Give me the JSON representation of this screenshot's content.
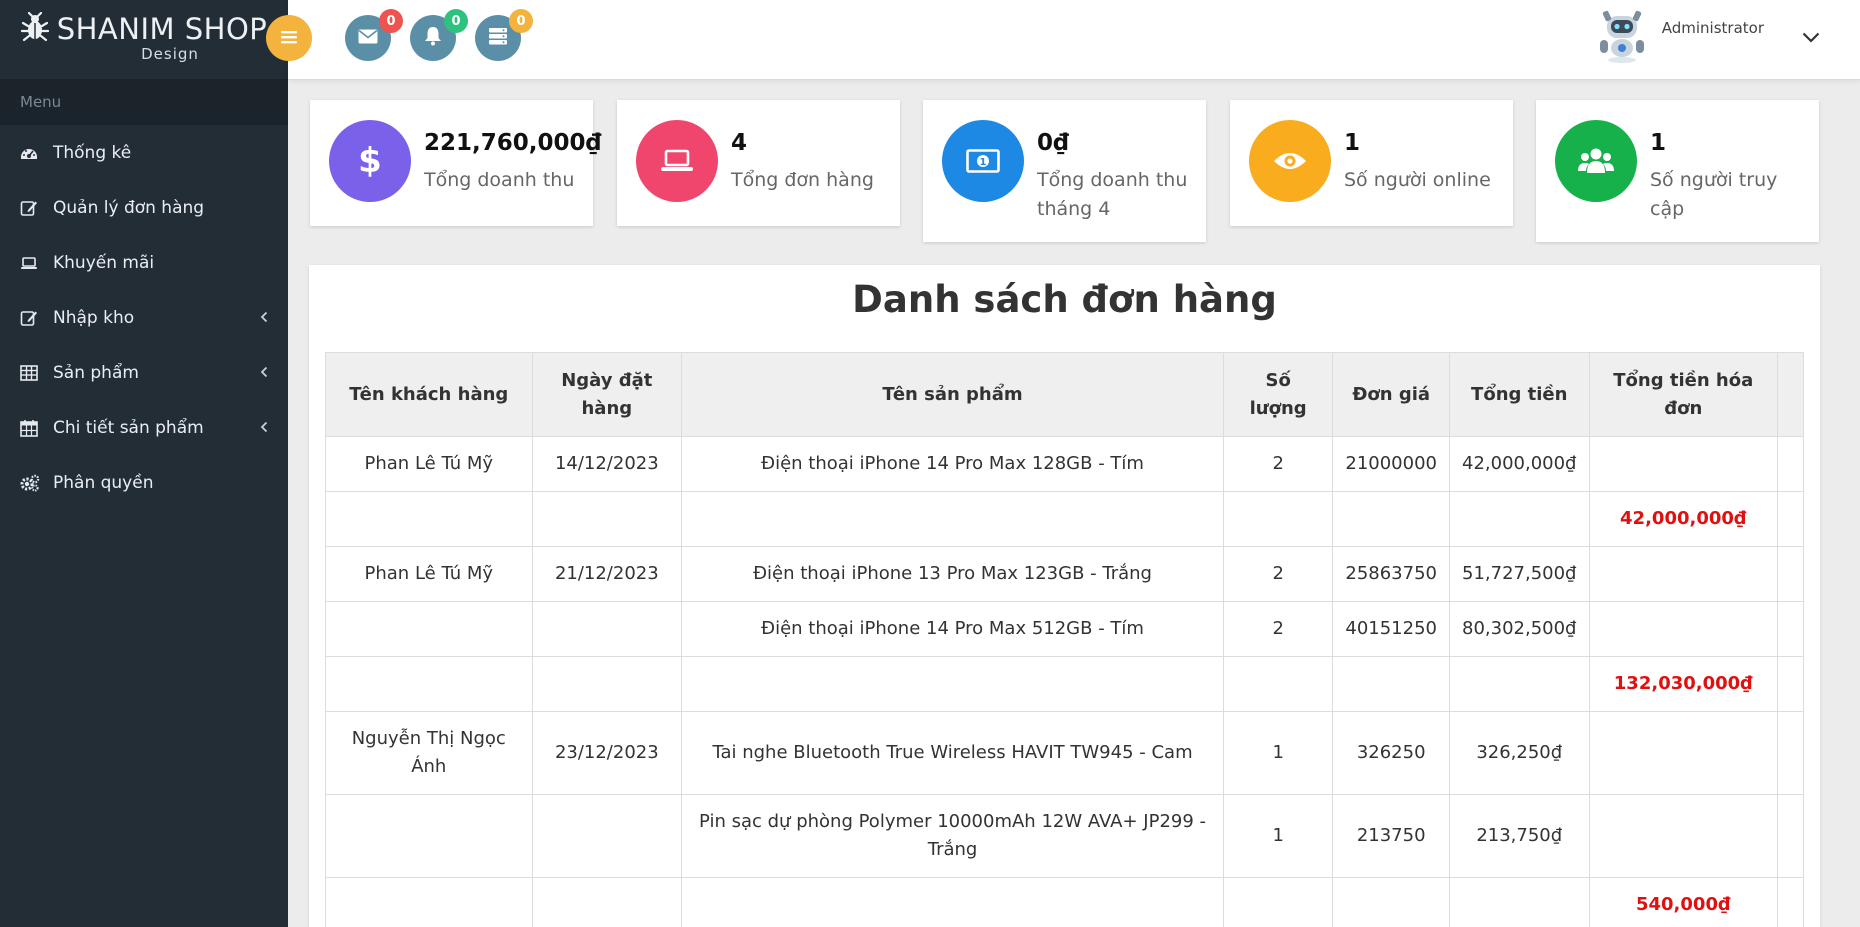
{
  "brand": {
    "title": "SHANIM SHOP",
    "subtitle": "Design"
  },
  "sidebar": {
    "menu_header": "Menu",
    "items": [
      {
        "label": "Thống kê",
        "icon": "dashboard-icon",
        "has_submenu": false
      },
      {
        "label": "Quản lý đơn hàng",
        "icon": "edit-icon",
        "has_submenu": false
      },
      {
        "label": "Khuyến mãi",
        "icon": "laptop-icon",
        "has_submenu": false
      },
      {
        "label": "Nhập kho",
        "icon": "edit-icon",
        "has_submenu": true
      },
      {
        "label": "Sản phẩm",
        "icon": "table-icon",
        "has_submenu": true
      },
      {
        "label": "Chi tiết sản phẩm",
        "icon": "calendar-icon",
        "has_submenu": true
      },
      {
        "label": "Phân quyền",
        "icon": "gears-icon",
        "has_submenu": false
      }
    ]
  },
  "header": {
    "badges": {
      "messages": "0",
      "notifications": "0",
      "tasks": "0"
    },
    "user_name": "Administrator"
  },
  "stats": [
    {
      "value": "221,760,000₫",
      "label": "Tổng doanh thu",
      "icon": "dollar-icon",
      "color": "#7b61ea"
    },
    {
      "value": "4",
      "label": "Tổng đơn hàng",
      "icon": "laptop-icon",
      "color": "#f0466e"
    },
    {
      "value": "0₫",
      "label": "Tổng doanh thu tháng 4",
      "icon": "money-icon",
      "color": "#1e88e5"
    },
    {
      "value": "1",
      "label": "Số người online",
      "icon": "eye-icon",
      "color": "#f9ac1e"
    },
    {
      "value": "1",
      "label": "Số người truy cập",
      "icon": "users-icon",
      "color": "#16b14b"
    }
  ],
  "orders": {
    "title": "Danh sách đơn hàng",
    "columns": [
      "Tên khách hàng",
      "Ngày đặt hàng",
      "Tên sản phẩm",
      "Số lượng",
      "Đơn giá",
      "Tổng tiền",
      "Tổng tiền hóa đơn"
    ],
    "rows": [
      {
        "customer": "Phan Lê Tú Mỹ",
        "date": "14/12/2023",
        "product": "Điện thoại iPhone 14 Pro Max 128GB - Tím",
        "qty": "2",
        "price": "21000000",
        "total": "42,000,000₫",
        "invoice_total": ""
      },
      {
        "customer": "",
        "date": "",
        "product": "",
        "qty": "",
        "price": "",
        "total": "",
        "invoice_total": "42,000,000₫"
      },
      {
        "customer": "Phan Lê Tú Mỹ",
        "date": "21/12/2023",
        "product": "Điện thoại iPhone 13 Pro Max 123GB - Trắng",
        "qty": "2",
        "price": "25863750",
        "total": "51,727,500₫",
        "invoice_total": ""
      },
      {
        "customer": "",
        "date": "",
        "product": "Điện thoại iPhone 14 Pro Max 512GB - Tím",
        "qty": "2",
        "price": "40151250",
        "total": "80,302,500₫",
        "invoice_total": ""
      },
      {
        "customer": "",
        "date": "",
        "product": "",
        "qty": "",
        "price": "",
        "total": "",
        "invoice_total": "132,030,000₫"
      },
      {
        "customer": "Nguyễn Thị Ngọc Ánh",
        "date": "23/12/2023",
        "product": "Tai nghe Bluetooth True Wireless HAVIT TW945 - Cam",
        "qty": "1",
        "price": "326250",
        "total": "326,250₫",
        "invoice_total": ""
      },
      {
        "customer": "",
        "date": "",
        "product": "Pin sạc dự phòng Polymer 10000mAh 12W AVA+ JP299 - Trắng",
        "qty": "1",
        "price": "213750",
        "total": "213,750₫",
        "invoice_total": ""
      },
      {
        "customer": "",
        "date": "",
        "product": "",
        "qty": "",
        "price": "",
        "total": "",
        "invoice_total": "540,000₫"
      }
    ]
  },
  "colors": {
    "sidebar_bg": "#232d36",
    "accent_red": "#e01010",
    "header_btn": "#5b8fa8",
    "menu_toggle": "#f4b33d"
  }
}
